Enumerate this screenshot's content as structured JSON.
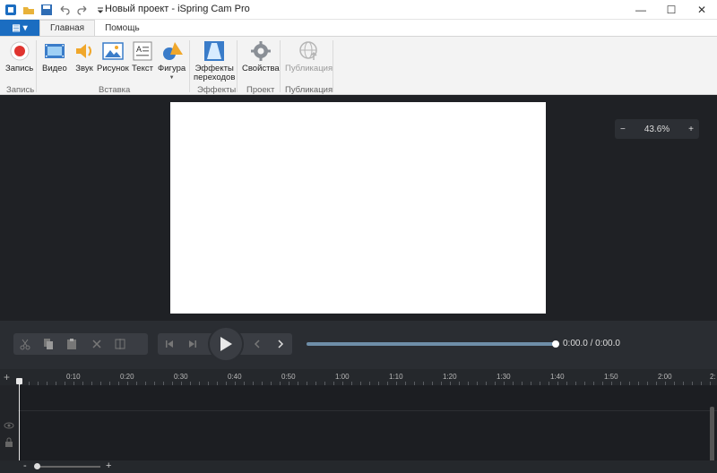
{
  "window": {
    "title": "Новый проект - iSpring Cam Pro",
    "minimize": "—",
    "maximize": "☐",
    "close": "✕"
  },
  "tabs": {
    "file": "▤ ▾",
    "items": [
      "Главная",
      "Помощь"
    ]
  },
  "ribbon": {
    "buttons": {
      "record": "Запись",
      "video": "Видео",
      "audio": "Звук",
      "picture": "Рисунок",
      "text": "Текст",
      "shape": "Фигура",
      "transitions_line1": "Эффекты",
      "transitions_line2": "переходов",
      "properties": "Свойства",
      "publish": "Публикация"
    },
    "groups": {
      "record": "Запись",
      "insert": "Вставка",
      "effects": "Эффекты",
      "project": "Проект",
      "publish": "Публикация"
    }
  },
  "zoom": {
    "minus": "−",
    "value": "43.6%",
    "plus": "+"
  },
  "playback": {
    "time": "0:00.0 / 0:00.0",
    "progress": 1.0
  },
  "timeline": {
    "add": "+",
    "ticks": [
      "0:10",
      "0:20",
      "0:30",
      "0:40",
      "0:50",
      "1:00",
      "1:10",
      "1:20",
      "1:30",
      "1:40",
      "1:50",
      "2:00",
      "2:"
    ],
    "zoom_minus": "-",
    "zoom_plus": "+"
  },
  "colors": {
    "accent": "#1b6dc1",
    "record": "#e0342f",
    "canvas_bg": "#1f2125",
    "progress": "#6e8ea8"
  }
}
